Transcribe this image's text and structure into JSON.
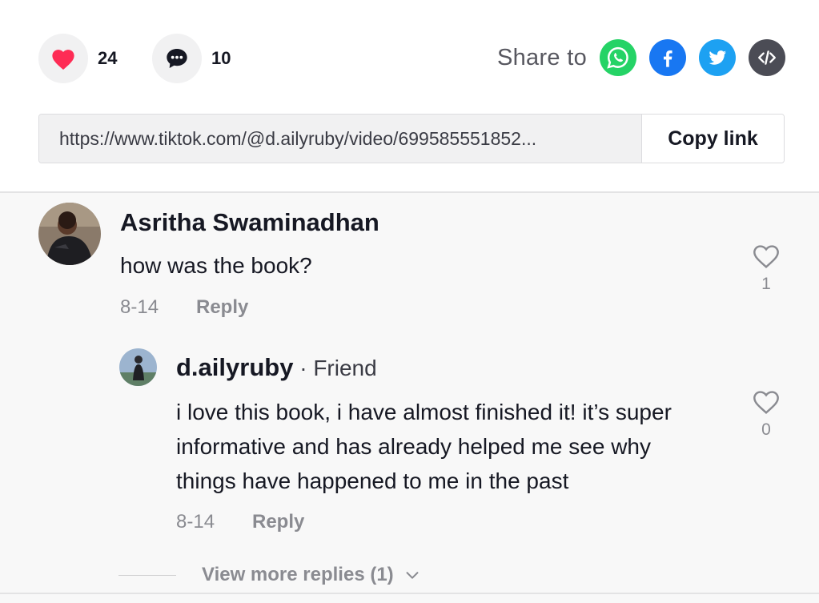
{
  "actions": {
    "likes": "24",
    "comments": "10"
  },
  "share": {
    "label": "Share to",
    "platforms": [
      "whatsapp",
      "facebook",
      "twitter",
      "embed"
    ]
  },
  "link": {
    "url": "https://www.tiktok.com/@d.ailyruby/video/699585551852...",
    "copy_label": "Copy link"
  },
  "comments": [
    {
      "author": "Asritha Swaminadhan",
      "text": "how was the book?",
      "date": "8-14",
      "reply_label": "Reply",
      "likes": "1"
    }
  ],
  "reply": {
    "author": "d.ailyruby",
    "badge": " · Friend",
    "lines": [
      "i love this book, i have almost finished it! it’s super",
      "informative and has already helped me see why",
      "things have happened to me in the past"
    ],
    "date": "8-14",
    "reply_label": "Reply",
    "likes": "0"
  },
  "view_more": "View more replies (1)",
  "colors": {
    "like_red": "#fe2c55",
    "whatsapp": "#25d366",
    "facebook": "#1877f2",
    "twitter": "#1da1f2",
    "embed": "#4b4c55"
  }
}
